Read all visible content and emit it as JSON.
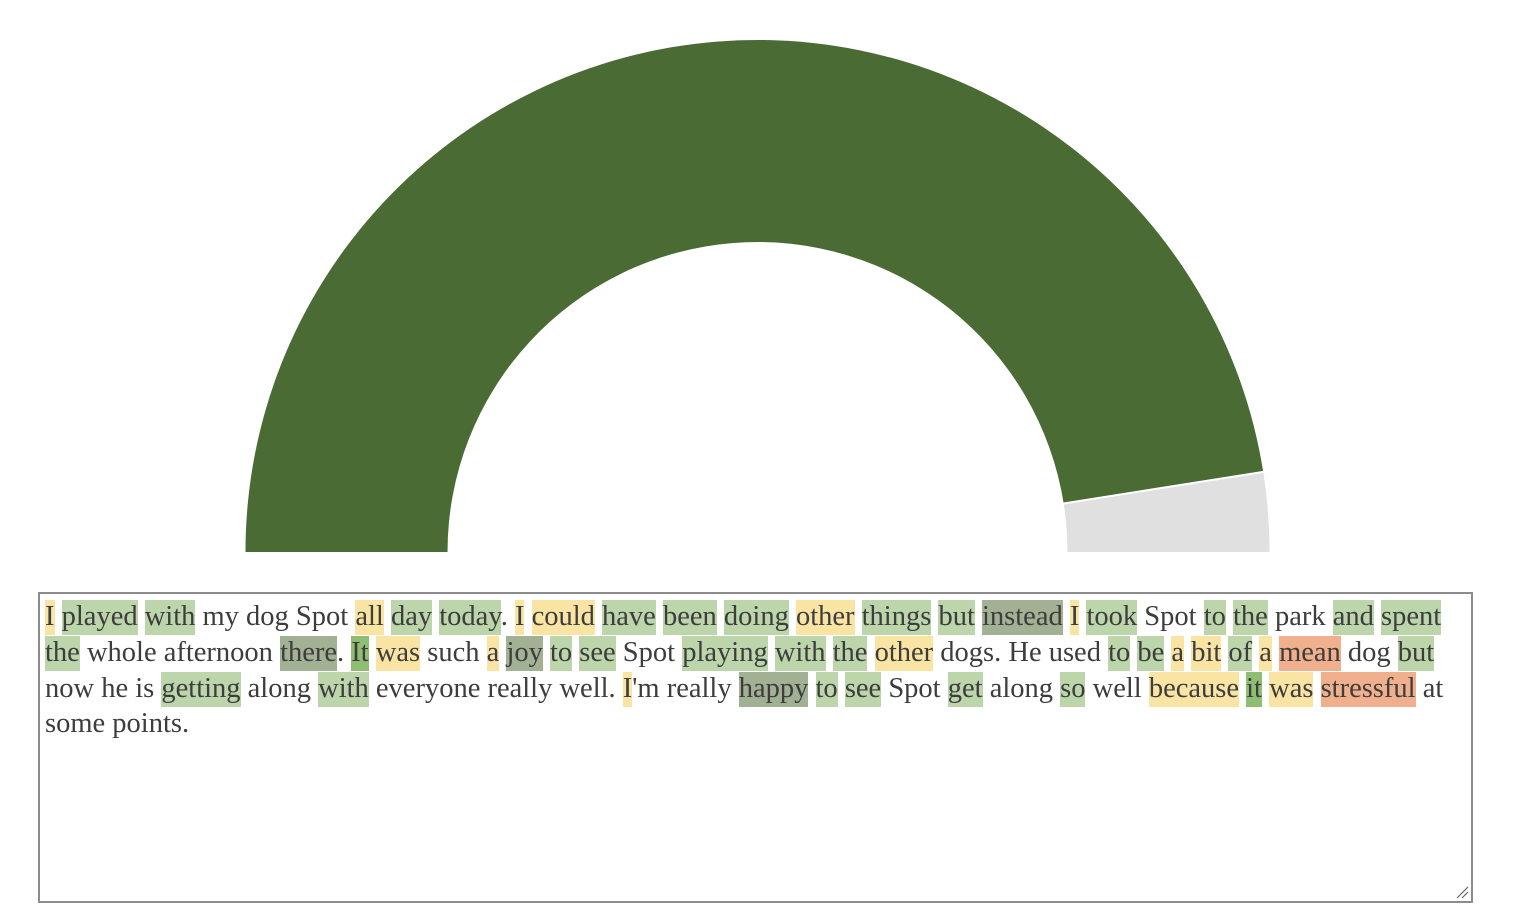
{
  "gauge": {
    "value": 0.95,
    "fill_color": "#4a6b34",
    "track_color": "#e0e0e0",
    "separator_color": "#ffffff"
  },
  "sentiment_colors": {
    "pos": "#bcd5ab",
    "strong": "#8fbe73",
    "dark": "#a2b093",
    "neu": "#f9e4a4",
    "neg": "#f1b08d"
  },
  "text_tokens": [
    {
      "t": "I",
      "s": "neu"
    },
    {
      "t": " "
    },
    {
      "t": "played",
      "s": "pos"
    },
    {
      "t": " "
    },
    {
      "t": "with",
      "s": "pos"
    },
    {
      "t": " my dog Spot "
    },
    {
      "t": "all",
      "s": "neu"
    },
    {
      "t": " "
    },
    {
      "t": "day",
      "s": "pos"
    },
    {
      "t": " "
    },
    {
      "t": "today",
      "s": "pos"
    },
    {
      "t": ". "
    },
    {
      "t": "I",
      "s": "neu"
    },
    {
      "t": " "
    },
    {
      "t": "could",
      "s": "neu"
    },
    {
      "t": " "
    },
    {
      "t": "have",
      "s": "pos"
    },
    {
      "t": " "
    },
    {
      "t": "been",
      "s": "pos"
    },
    {
      "t": " "
    },
    {
      "t": "doing",
      "s": "pos"
    },
    {
      "t": " "
    },
    {
      "t": "other",
      "s": "neu"
    },
    {
      "t": " "
    },
    {
      "t": "things",
      "s": "pos"
    },
    {
      "t": " "
    },
    {
      "t": "but",
      "s": "pos"
    },
    {
      "t": " "
    },
    {
      "t": "instead",
      "s": "dark"
    },
    {
      "t": " "
    },
    {
      "t": "I",
      "s": "neu"
    },
    {
      "t": " "
    },
    {
      "t": "took",
      "s": "pos"
    },
    {
      "t": " Spot "
    },
    {
      "t": "to",
      "s": "pos"
    },
    {
      "t": " "
    },
    {
      "t": "the",
      "s": "pos"
    },
    {
      "t": " park "
    },
    {
      "t": "and",
      "s": "pos"
    },
    {
      "t": " "
    },
    {
      "t": "spent",
      "s": "pos"
    },
    {
      "t": " "
    },
    {
      "t": "the",
      "s": "pos"
    },
    {
      "t": " whole afternoon "
    },
    {
      "t": "there",
      "s": "dark"
    },
    {
      "t": ". "
    },
    {
      "t": "It",
      "s": "strong"
    },
    {
      "t": " "
    },
    {
      "t": "was",
      "s": "neu"
    },
    {
      "t": " such "
    },
    {
      "t": "a",
      "s": "neu"
    },
    {
      "t": " "
    },
    {
      "t": "joy",
      "s": "dark"
    },
    {
      "t": " "
    },
    {
      "t": "to",
      "s": "pos"
    },
    {
      "t": " "
    },
    {
      "t": "see",
      "s": "pos"
    },
    {
      "t": " Spot "
    },
    {
      "t": "playing",
      "s": "pos"
    },
    {
      "t": " "
    },
    {
      "t": "with",
      "s": "pos"
    },
    {
      "t": " "
    },
    {
      "t": "the",
      "s": "pos"
    },
    {
      "t": " "
    },
    {
      "t": "other",
      "s": "neu"
    },
    {
      "t": " dogs. He used "
    },
    {
      "t": "to",
      "s": "pos"
    },
    {
      "t": " "
    },
    {
      "t": "be",
      "s": "pos"
    },
    {
      "t": " "
    },
    {
      "t": "a",
      "s": "neu"
    },
    {
      "t": " "
    },
    {
      "t": "bit",
      "s": "neu"
    },
    {
      "t": " "
    },
    {
      "t": "of",
      "s": "pos"
    },
    {
      "t": " "
    },
    {
      "t": "a",
      "s": "neu"
    },
    {
      "t": " "
    },
    {
      "t": "mean",
      "s": "neg"
    },
    {
      "t": " dog "
    },
    {
      "t": "but",
      "s": "pos"
    },
    {
      "t": " now he is "
    },
    {
      "t": "getting",
      "s": "pos"
    },
    {
      "t": " along "
    },
    {
      "t": "with",
      "s": "pos"
    },
    {
      "t": " everyone really well. "
    },
    {
      "t": "I",
      "s": "neu"
    },
    {
      "t": "'m really "
    },
    {
      "t": "happy",
      "s": "dark"
    },
    {
      "t": " "
    },
    {
      "t": "to",
      "s": "pos"
    },
    {
      "t": " "
    },
    {
      "t": "see",
      "s": "pos"
    },
    {
      "t": " Spot "
    },
    {
      "t": "get",
      "s": "pos"
    },
    {
      "t": " along "
    },
    {
      "t": "so",
      "s": "pos"
    },
    {
      "t": " well "
    },
    {
      "t": "because",
      "s": "neu"
    },
    {
      "t": " "
    },
    {
      "t": "it",
      "s": "strong"
    },
    {
      "t": " "
    },
    {
      "t": "was",
      "s": "neu"
    },
    {
      "t": " "
    },
    {
      "t": "stressful",
      "s": "neg"
    },
    {
      "t": " at some points."
    }
  ]
}
